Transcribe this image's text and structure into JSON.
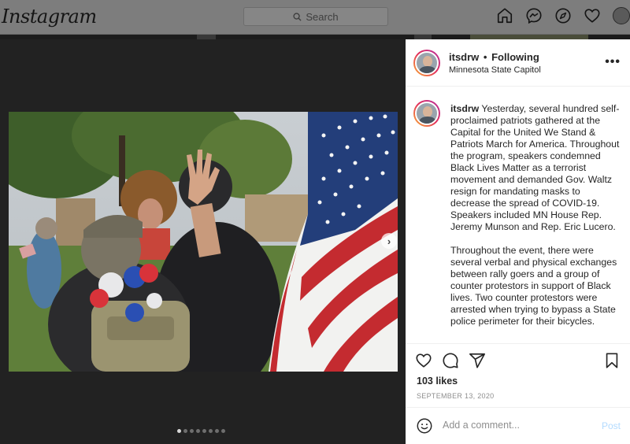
{
  "nav": {
    "logo": "Instagram",
    "search_placeholder": "Search",
    "icons": [
      "home-icon",
      "messenger-icon",
      "explore-icon",
      "activity-heart-icon",
      "profile-avatar"
    ]
  },
  "post": {
    "username": "itsdrw",
    "follow_status": "Following",
    "separator": "•",
    "location": "Minnesota State Capitol",
    "more_label": "•••",
    "caption_username": "itsdrw",
    "caption_p1": "Yesterday, several hundred self-proclaimed patriots gathered at the Capital for the United We Stand & Patriots March for America. Throughout the program, speakers condemned Black Lives Matter as a terrorist movement and demanded Gov. Waltz resign for mandating masks to decrease the spread of COVID-19. Speakers included MN House Rep. Jeremy Munson and Rep. Eric Lucero.",
    "caption_p2": "Throughout the event, there were several verbal and physical exchanges between rally goers and a group of counter protestors in support of Black lives. Two counter protestors were arrested when trying to bypass a State police perimeter for their bicycles.",
    "likes": "103 likes",
    "date": "SEPTEMBER 13, 2020",
    "comment_placeholder": "Add a comment...",
    "post_label": "Post",
    "carousel": {
      "count": 8,
      "active": 0
    },
    "next_label": "›"
  },
  "colors": {
    "accent_disabled": "#b3dbff",
    "text": "#262626",
    "muted": "#8e8e8e"
  }
}
